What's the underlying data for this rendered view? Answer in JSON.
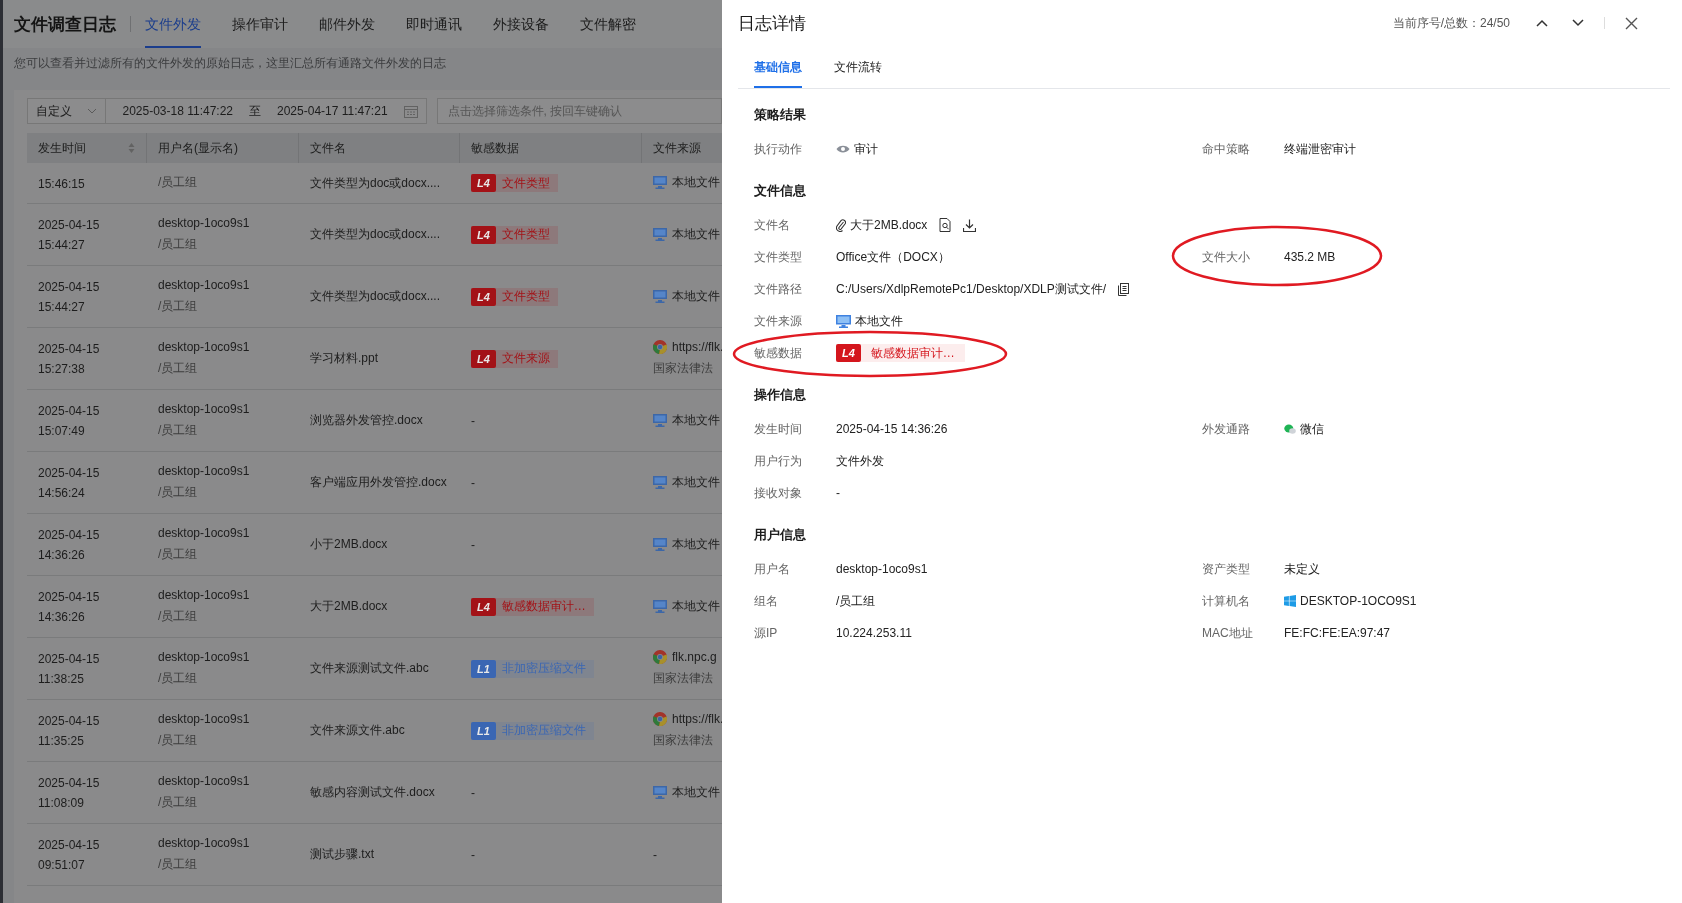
{
  "left": {
    "title": "文件调查日志",
    "tabs": [
      {
        "label": "文件外发",
        "selected": true
      },
      {
        "label": "操作审计",
        "selected": false
      },
      {
        "label": "邮件外发",
        "selected": false
      },
      {
        "label": "即时通讯",
        "selected": false
      },
      {
        "label": "外接设备",
        "selected": false
      },
      {
        "label": "文件解密",
        "selected": false
      }
    ],
    "description": "您可以查看并过滤所有的文件外发的原始日志，这里汇总所有通路文件外发的日志",
    "filter": {
      "range_type": "自定义",
      "start": "2025-03-18 11:47:22",
      "separator": "至",
      "end": "2025-04-17 11:47:21",
      "placeholder": "点击选择筛选条件, 按回车键确认"
    },
    "table": {
      "columns": [
        "发生时间",
        "用户名(显示名)",
        "文件名",
        "敏感数据",
        "文件来源"
      ],
      "rows": [
        {
          "time": "15:46:15",
          "group": "/员工组",
          "file": "文件类型为doc或docx....",
          "tag": {
            "level": "L4",
            "text": "文件类型",
            "color": "#a31217"
          },
          "source": {
            "kind": "local",
            "text": "本地文件"
          }
        },
        {
          "date": "2025-04-15",
          "time": "15:44:27",
          "user": "desktop-1oco9s1",
          "group": "/员工组",
          "file": "文件类型为doc或docx....",
          "tag": {
            "level": "L4",
            "text": "文件类型",
            "color": "#a31217"
          },
          "source": {
            "kind": "local",
            "text": "本地文件"
          }
        },
        {
          "date": "2025-04-15",
          "time": "15:44:27",
          "user": "desktop-1oco9s1",
          "group": "/员工组",
          "file": "文件类型为doc或docx....",
          "tag": {
            "level": "L4",
            "text": "文件类型",
            "color": "#a31217"
          },
          "source": {
            "kind": "local",
            "text": "本地文件"
          }
        },
        {
          "date": "2025-04-15",
          "time": "15:27:38",
          "user": "desktop-1oco9s1",
          "group": "/员工组",
          "file": "学习材料.ppt",
          "tag": {
            "level": "L4",
            "text": "文件来源",
            "color": "#a31217"
          },
          "source": {
            "kind": "web",
            "text": "https://flk.",
            "sub": "国家法律法"
          }
        },
        {
          "date": "2025-04-15",
          "time": "15:07:49",
          "user": "desktop-1oco9s1",
          "group": "/员工组",
          "file": "浏览器外发管控.docx",
          "tag_none": "-",
          "source": {
            "kind": "local",
            "text": "本地文件"
          }
        },
        {
          "date": "2025-04-15",
          "time": "14:56:24",
          "user": "desktop-1oco9s1",
          "group": "/员工组",
          "file": "客户端应用外发管控.docx",
          "tag_none": "-",
          "source": {
            "kind": "local",
            "text": "本地文件"
          }
        },
        {
          "date": "2025-04-15",
          "time": "14:36:26",
          "user": "desktop-1oco9s1",
          "group": "/员工组",
          "file": "小于2MB.docx",
          "tag_none": "-",
          "source": {
            "kind": "local",
            "text": "本地文件"
          }
        },
        {
          "date": "2025-04-15",
          "time": "14:36:26",
          "user": "desktop-1oco9s1",
          "group": "/员工组",
          "file": "大于2MB.docx",
          "tag": {
            "level": "L4",
            "text": "敏感数据审计…",
            "color": "#a31217"
          },
          "source": {
            "kind": "local",
            "text": "本地文件"
          }
        },
        {
          "date": "2025-04-15",
          "time": "11:38:25",
          "user": "desktop-1oco9s1",
          "group": "/员工组",
          "file": "文件来源测试文件.abc",
          "tag": {
            "level": "L1",
            "text": "非加密压缩文件",
            "color": "#3a66b3"
          },
          "source": {
            "kind": "web",
            "text": "flk.npc.g",
            "sub": "国家法律法"
          }
        },
        {
          "date": "2025-04-15",
          "time": "11:35:25",
          "user": "desktop-1oco9s1",
          "group": "/员工组",
          "file": "文件来源文件.abc",
          "tag": {
            "level": "L1",
            "text": "非加密压缩文件",
            "color": "#3a66b3"
          },
          "source": {
            "kind": "web",
            "text": "https://flk.",
            "sub": "国家法律法"
          }
        },
        {
          "date": "2025-04-15",
          "time": "11:08:09",
          "user": "desktop-1oco9s1",
          "group": "/员工组",
          "file": "敏感内容测试文件.docx",
          "tag_none": "-",
          "source": {
            "kind": "local",
            "text": "本地文件"
          }
        },
        {
          "date": "2025-04-15",
          "time": "09:51:07",
          "user": "desktop-1oco9s1",
          "group": "/员工组",
          "file": "测试步骤.txt",
          "tag_none": "-",
          "source": {
            "kind": "none",
            "text": "-"
          }
        }
      ]
    }
  },
  "detail": {
    "title": "日志详情",
    "counter": "当前序号/总数：24/50",
    "tabs": [
      {
        "label": "基础信息",
        "selected": true
      },
      {
        "label": "文件流转",
        "selected": false
      }
    ],
    "sections": [
      {
        "title": "策略结果",
        "rows": [
          [
            {
              "label": "执行动作",
              "kind": "audit",
              "value": "审计"
            },
            {
              "label": "命中策略",
              "kind": "text",
              "value": "终端泄密审计"
            }
          ]
        ]
      },
      {
        "title": "文件信息",
        "rows": [
          [
            {
              "label": "文件名",
              "kind": "file",
              "value": "大于2MB.docx"
            }
          ],
          [
            {
              "label": "文件类型",
              "kind": "text",
              "value": "Office文件（DOCX）"
            },
            {
              "label": "文件大小",
              "kind": "text",
              "value": "435.2 MB"
            }
          ],
          [
            {
              "label": "文件路径",
              "kind": "path",
              "value": "C:/Users/XdlpRemotePc1/Desktop/XDLP测试文件/"
            }
          ],
          [
            {
              "label": "文件来源",
              "kind": "local",
              "value": "本地文件"
            }
          ],
          [
            {
              "label": "敏感数据",
              "kind": "tag",
              "level": "L4",
              "value": "敏感数据审计…",
              "color": "#d4161d"
            }
          ]
        ]
      },
      {
        "title": "操作信息",
        "rows": [
          [
            {
              "label": "发生时间",
              "kind": "text",
              "value": "2025-04-15 14:36:26"
            },
            {
              "label": "外发通路",
              "kind": "wechat",
              "value": "微信"
            }
          ],
          [
            {
              "label": "用户行为",
              "kind": "text",
              "value": "文件外发"
            }
          ],
          [
            {
              "label": "接收对象",
              "kind": "text",
              "value": "-"
            }
          ]
        ]
      },
      {
        "title": "用户信息",
        "rows": [
          [
            {
              "label": "用户名",
              "kind": "text",
              "value": "desktop-1oco9s1"
            },
            {
              "label": "资产类型",
              "kind": "text",
              "value": "未定义"
            }
          ],
          [
            {
              "label": "组名",
              "kind": "text",
              "value": "/员工组"
            },
            {
              "label": "计算机名",
              "kind": "windows",
              "value": "DESKTOP-1OCO9S1"
            }
          ],
          [
            {
              "label": "源IP",
              "kind": "text",
              "value": "10.224.253.11"
            },
            {
              "label": "MAC地址",
              "kind": "text",
              "value": "FE:FC:FE:EA:97:47"
            }
          ]
        ]
      }
    ]
  }
}
